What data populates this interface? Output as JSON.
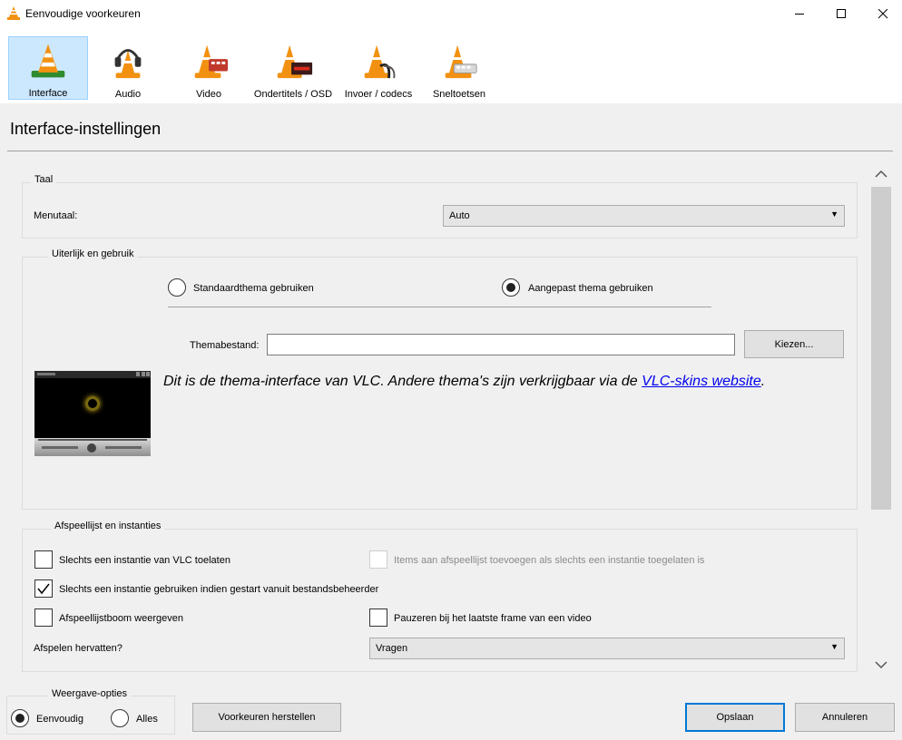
{
  "window": {
    "title": "Eenvoudige voorkeuren"
  },
  "toolbar": {
    "items": [
      {
        "label": "Interface"
      },
      {
        "label": "Audio"
      },
      {
        "label": "Video"
      },
      {
        "label": "Ondertitels / OSD"
      },
      {
        "label": "Invoer / codecs"
      },
      {
        "label": "Sneltoetsen"
      }
    ],
    "selected": "Interface"
  },
  "heading": "Interface-instellingen",
  "taal": {
    "group_title": "Taal",
    "menutaal_label": "Menutaal:",
    "menutaal_value": "Auto"
  },
  "uiterlijk": {
    "group_title": "Uiterlijk en gebruik",
    "radio_standaard": "Standaardthema gebruiken",
    "radio_aangepast": "Aangepast thema gebruiken",
    "selected_theme": "Aangepast thema gebruiken",
    "themabestand_label": "Themabestand:",
    "themabestand_value": "",
    "kiezen_button": "Kiezen...",
    "description": "Dit is de thema-interface van VLC. Andere thema's zijn verkrijgbaar via de ",
    "link_text": "VLC-skins website",
    "description_end": "."
  },
  "afspeellijst": {
    "group_title": "Afspeellijst en instanties",
    "cb_one_instance": {
      "label": "Slechts een instantie van VLC toelaten",
      "checked": false
    },
    "cb_enqueue": {
      "label": "Items aan afspeellijst toevoegen als slechts een instantie toegelaten is",
      "checked": false,
      "enabled": false
    },
    "cb_file_manager": {
      "label": "Slechts een instantie gebruiken indien gestart vanuit bestandsbeheerder",
      "checked": true
    },
    "cb_tree": {
      "label": "Afspeellijstboom weergeven",
      "checked": false
    },
    "cb_pause_last": {
      "label": "Pauzeren bij het laatste frame van een video",
      "checked": false
    },
    "resume_label": "Afspelen hervatten?",
    "resume_value": "Vragen"
  },
  "weergave": {
    "group_title": "Weergave-opties",
    "radio_eenvoudig": "Eenvoudig",
    "radio_alles": "Alles",
    "selected": "Eenvoudig"
  },
  "buttons": {
    "reset": "Voorkeuren herstellen",
    "save": "Opslaan",
    "cancel": "Annuleren"
  },
  "colors": {
    "selection": "#cce8ff",
    "selection_border": "#99d1ff",
    "default_button_border": "#0078d7",
    "cone_orange": "#f29111",
    "link": "#0000ee"
  },
  "icons": {
    "app": "vlc-cone-icon",
    "interface": "vlc-cone-interface-icon",
    "audio": "vlc-cone-headphones-icon",
    "video": "vlc-cone-film-icon",
    "subtitles": "vlc-cone-subtitles-icon",
    "input": "vlc-cone-cable-icon",
    "hotkeys": "vlc-cone-keyboard-icon"
  }
}
